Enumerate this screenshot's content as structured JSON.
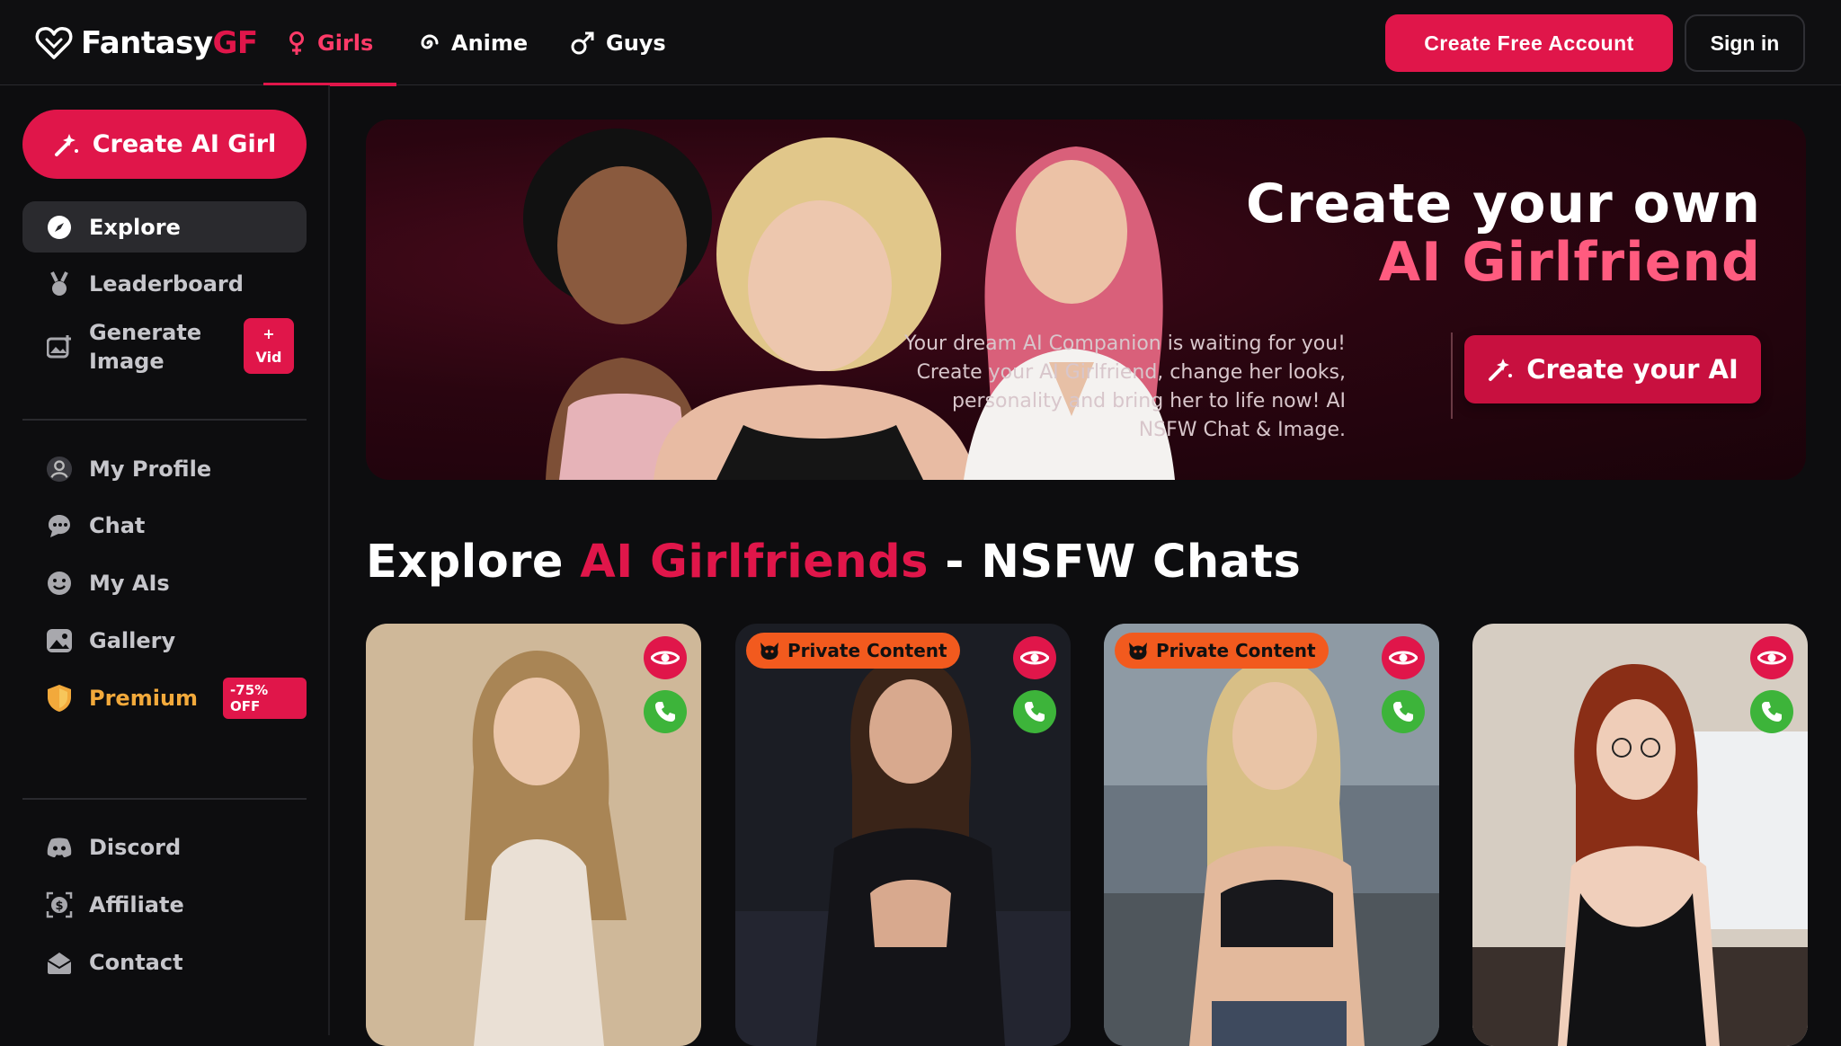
{
  "brand": {
    "name_part1": "Fantasy",
    "name_part2": "GF",
    "accent": "#e0164a"
  },
  "nav": {
    "tabs": [
      {
        "label": "Girls",
        "icon": "female-icon",
        "active": true
      },
      {
        "label": "Anime",
        "icon": "swirl-icon",
        "active": false
      },
      {
        "label": "Guys",
        "icon": "male-icon",
        "active": false
      }
    ],
    "create_account": "Create Free Account",
    "sign_in": "Sign in"
  },
  "sidebar": {
    "create_button": "Create AI Girl",
    "items": [
      {
        "label": "Explore",
        "icon": "compass-icon",
        "active": true
      },
      {
        "label": "Leaderboard",
        "icon": "medal-icon"
      },
      {
        "label_line1": "Generate",
        "label_line2": "Image",
        "icon": "image-plus-icon",
        "badge_plus": "+",
        "badge_text": "Vid"
      },
      {
        "label": "My Profile",
        "icon": "user-icon"
      },
      {
        "label": "Chat",
        "icon": "chat-icon"
      },
      {
        "label": "My AIs",
        "icon": "smile-icon"
      },
      {
        "label": "Gallery",
        "icon": "gallery-icon"
      },
      {
        "label": "Premium",
        "icon": "shield-icon",
        "badge": "-75% OFF"
      },
      {
        "label": "Discord",
        "icon": "discord-icon"
      },
      {
        "label": "Affiliate",
        "icon": "dollar-icon"
      },
      {
        "label": "Contact",
        "icon": "mail-icon"
      }
    ]
  },
  "hero": {
    "title_line1": "Create your own",
    "title_line2": "AI Girlfriend",
    "description": "Your dream AI Companion is waiting for you! Create your AI Girlfriend, change her looks, personality and bring her to life now! AI NSFW Chat & Image.",
    "cta": "Create your AI"
  },
  "section": {
    "title_part1": "Explore ",
    "title_accent": "AI Girlfriends",
    "title_part2": " - NSFW Chats"
  },
  "cards": [
    {
      "private": false,
      "private_label": ""
    },
    {
      "private": true,
      "private_label": "Private Content"
    },
    {
      "private": true,
      "private_label": "Private Content"
    },
    {
      "private": false,
      "private_label": ""
    }
  ]
}
